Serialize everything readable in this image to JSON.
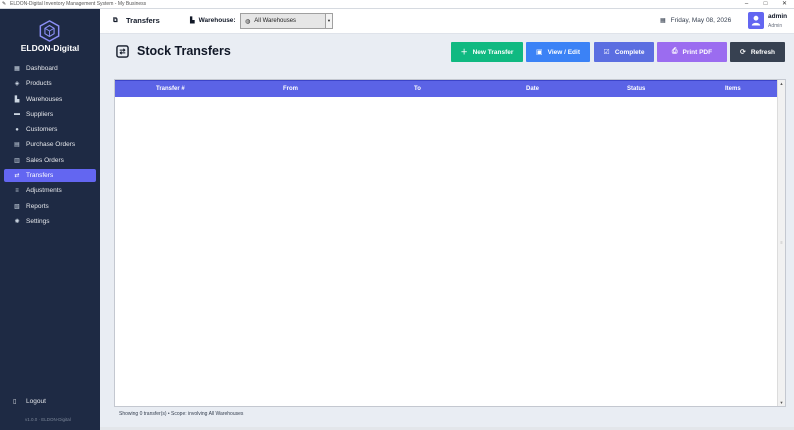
{
  "window": {
    "title": "ELDON-Digital Inventory Management System - My Business",
    "controls": [
      "–",
      "□",
      "✕"
    ]
  },
  "sidebar": {
    "brand": "ELDON-Digital",
    "items": [
      {
        "label": "Dashboard",
        "icon": "dashboard-icon"
      },
      {
        "label": "Products",
        "icon": "box-icon"
      },
      {
        "label": "Warehouses",
        "icon": "warehouse-icon"
      },
      {
        "label": "Suppliers",
        "icon": "truck-icon"
      },
      {
        "label": "Customers",
        "icon": "users-icon"
      },
      {
        "label": "Purchase Orders",
        "icon": "cart-icon"
      },
      {
        "label": "Sales Orders",
        "icon": "receipt-icon"
      },
      {
        "label": "Transfers",
        "icon": "transfer-icon",
        "active": true
      },
      {
        "label": "Adjustments",
        "icon": "sliders-icon"
      },
      {
        "label": "Reports",
        "icon": "chart-icon"
      },
      {
        "label": "Settings",
        "icon": "gear-icon"
      }
    ],
    "logout": "Logout",
    "version": "v1.0.0 · ELDON-Digital"
  },
  "topbar": {
    "section": "Transfers",
    "warehouse_label": "Warehouse:",
    "warehouse_value": "All Warehouses",
    "date": "Friday, May 08, 2026",
    "user_name": "admin",
    "user_role": "Admin"
  },
  "page": {
    "title": "Stock Transfers",
    "buttons": {
      "new": "New Transfer",
      "view": "View / Edit",
      "complete": "Complete",
      "print": "Print PDF",
      "refresh": "Refresh"
    }
  },
  "table": {
    "columns": [
      "Transfer #",
      "From",
      "To",
      "Date",
      "Status",
      "Items"
    ],
    "rows": []
  },
  "footer": {
    "status": "Showing 0 transfer(s) • Scope: involving All Warehouses"
  },
  "colors": {
    "sidebar": "#1e2a44",
    "accent": "#6366f1",
    "new": "#10b981",
    "view": "#3b82f6",
    "complete": "#5b6ee1",
    "print": "#9b6cf0",
    "refresh": "#374151"
  }
}
